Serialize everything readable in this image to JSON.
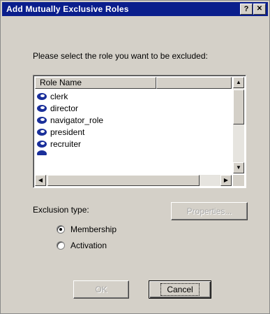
{
  "window": {
    "title": "Add Mutually Exclusive Roles",
    "help_button": "?",
    "close_button": "✕"
  },
  "prompt": "Please select the role you want to be excluded:",
  "list": {
    "columns": [
      "Role Name",
      ""
    ],
    "rows": [
      "clerk",
      "director",
      "navigator_role",
      "president",
      "recruiter"
    ],
    "icon": "role-icon",
    "icon_color": "#1a2f9a"
  },
  "exclusion": {
    "label": "Exclusion type:",
    "options": [
      {
        "label": "Membership",
        "selected": true
      },
      {
        "label": "Activation",
        "selected": false
      }
    ]
  },
  "buttons": {
    "properties": "Properties...",
    "ok": "OK",
    "cancel": "Cancel"
  }
}
